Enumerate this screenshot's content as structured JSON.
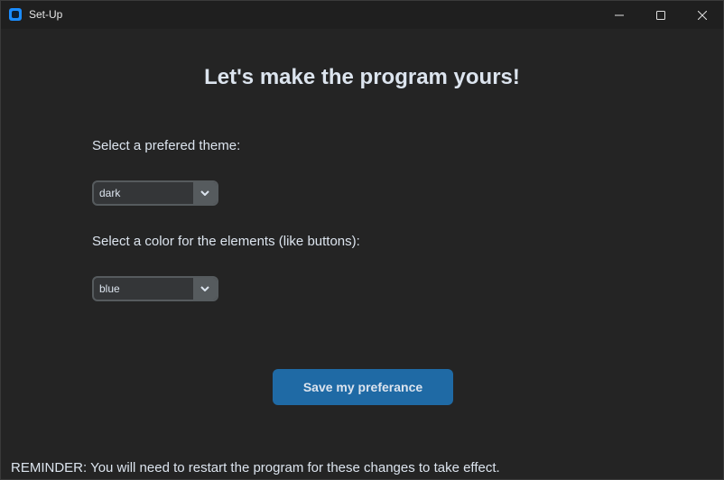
{
  "window": {
    "title": "Set-Up",
    "controls": {
      "minimize_icon": "minimize-icon",
      "maximize_icon": "maximize-icon",
      "close_icon": "close-icon"
    }
  },
  "main": {
    "heading": "Let's make the program yours!",
    "theme": {
      "label": "Select a prefered theme:",
      "selected": "dark"
    },
    "color": {
      "label": "Select a color for the elements (like buttons):",
      "selected": "blue"
    },
    "save_button": "Save my preferance",
    "reminder": "REMINDER:  You will need to restart the program for these changes to take effect."
  },
  "colors": {
    "background": "#242424",
    "titlebar": "#1f1f1f",
    "accent": "#1f6aa5",
    "text": "#dce4ee",
    "combo_bg": "#343638",
    "combo_border": "#565b5e"
  }
}
